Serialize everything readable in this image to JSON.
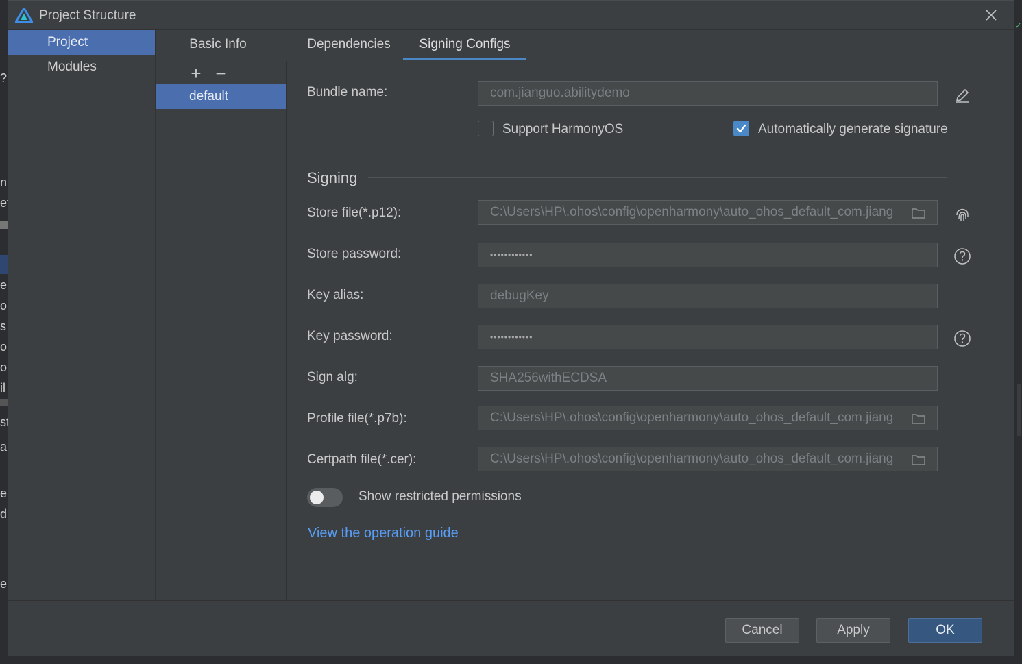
{
  "window": {
    "title": "Project Structure"
  },
  "background_fragments": [
    "?",
    "n",
    "et",
    "e",
    "o",
    "s",
    "or",
    "or",
    "il",
    "st",
    "a",
    "e",
    "d",
    "e"
  ],
  "nav": {
    "items": [
      {
        "label": "Project",
        "selected": true
      },
      {
        "label": "Modules",
        "selected": false
      }
    ]
  },
  "tabs": [
    {
      "label": "Basic Info",
      "active": false
    },
    {
      "label": "Dependencies",
      "active": false
    },
    {
      "label": "Signing Configs",
      "active": true
    }
  ],
  "config_list": {
    "add_symbol": "+",
    "remove_symbol": "−",
    "items": [
      {
        "label": "default",
        "selected": true
      }
    ]
  },
  "form": {
    "bundle_name": {
      "label": "Bundle name:",
      "value": "com.jianguo.abilitydemo"
    },
    "support_harmonyos": {
      "label": "Support HarmonyOS",
      "checked": false
    },
    "auto_sign": {
      "label": "Automatically generate signature",
      "checked": true
    },
    "signing_title": "Signing",
    "store_file": {
      "label": "Store file(*.p12):",
      "value": "C:\\Users\\HP\\.ohos\\config\\openharmony\\auto_ohos_default_com.jiang"
    },
    "store_password": {
      "label": "Store password:",
      "value": "••••••••••••"
    },
    "key_alias": {
      "label": "Key alias:",
      "value": "debugKey"
    },
    "key_password": {
      "label": "Key password:",
      "value": "••••••••••••"
    },
    "sign_alg": {
      "label": "Sign alg:",
      "value": "SHA256withECDSA"
    },
    "profile_file": {
      "label": "Profile file(*.p7b):",
      "value": "C:\\Users\\HP\\.ohos\\config\\openharmony\\auto_ohos_default_com.jiang"
    },
    "certpath_file": {
      "label": "Certpath file(*.cer):",
      "value": "C:\\Users\\HP\\.ohos\\config\\openharmony\\auto_ohos_default_com.jiang"
    },
    "restricted_permissions": {
      "label": "Show restricted permissions",
      "on": false
    },
    "guide_link": "View the operation guide"
  },
  "footer": {
    "cancel": "Cancel",
    "apply": "Apply",
    "ok": "OK"
  },
  "colors": {
    "accent": "#4a88c7",
    "selection": "#4b6eaf",
    "link": "#589df6",
    "primary_button": "#365880",
    "logo": "#3d8ee8"
  },
  "icons": {
    "logo": "deveco-logo-icon",
    "close": "close-icon",
    "edit": "pencil-edit-icon",
    "fingerprint": "fingerprint-icon",
    "help": "question-circle-icon",
    "folder": "folder-icon",
    "check": "checkmark-icon"
  }
}
